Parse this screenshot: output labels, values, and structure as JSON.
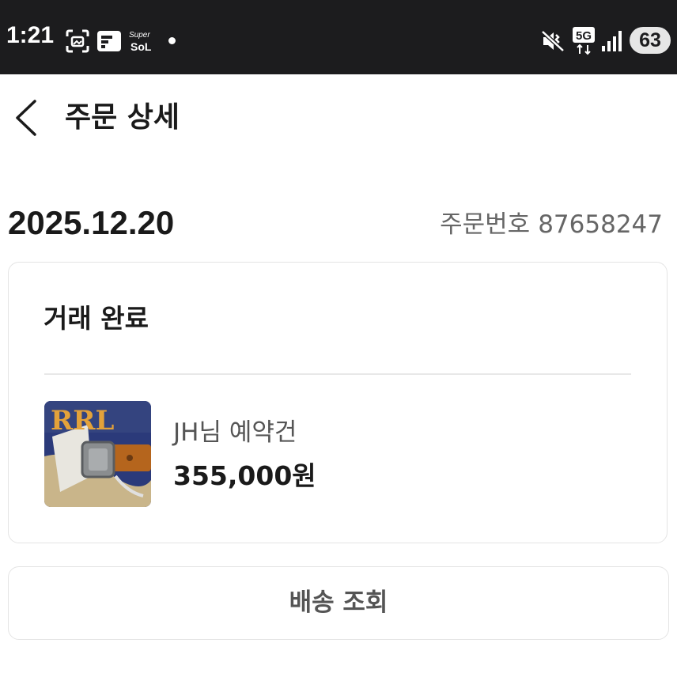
{
  "status_bar": {
    "time": "1:21",
    "icons": [
      "screenshot-icon",
      "flipboard-icon",
      "supersol-app-icon",
      "notification-dot",
      "mute-vibrate-icon",
      "5g-data-icon",
      "signal-icon"
    ],
    "network": "5G",
    "battery": "63"
  },
  "header": {
    "title": "주문 상세",
    "back_icon": "chevron-left-icon"
  },
  "order": {
    "date": "2025.12.20",
    "number_label": "주문번호",
    "number": "87658247"
  },
  "card": {
    "status": "거래 완료",
    "item": {
      "thumbnail": "product-thumbnail",
      "name": "JH님 예약건",
      "price": "355,000원"
    }
  },
  "actions": {
    "track_label": "배송 조회"
  },
  "colors": {
    "statusbar_bg": "#1c1c1e",
    "text_primary": "#1a1a1a",
    "text_secondary": "#666666",
    "border": "#e4e4e4"
  }
}
